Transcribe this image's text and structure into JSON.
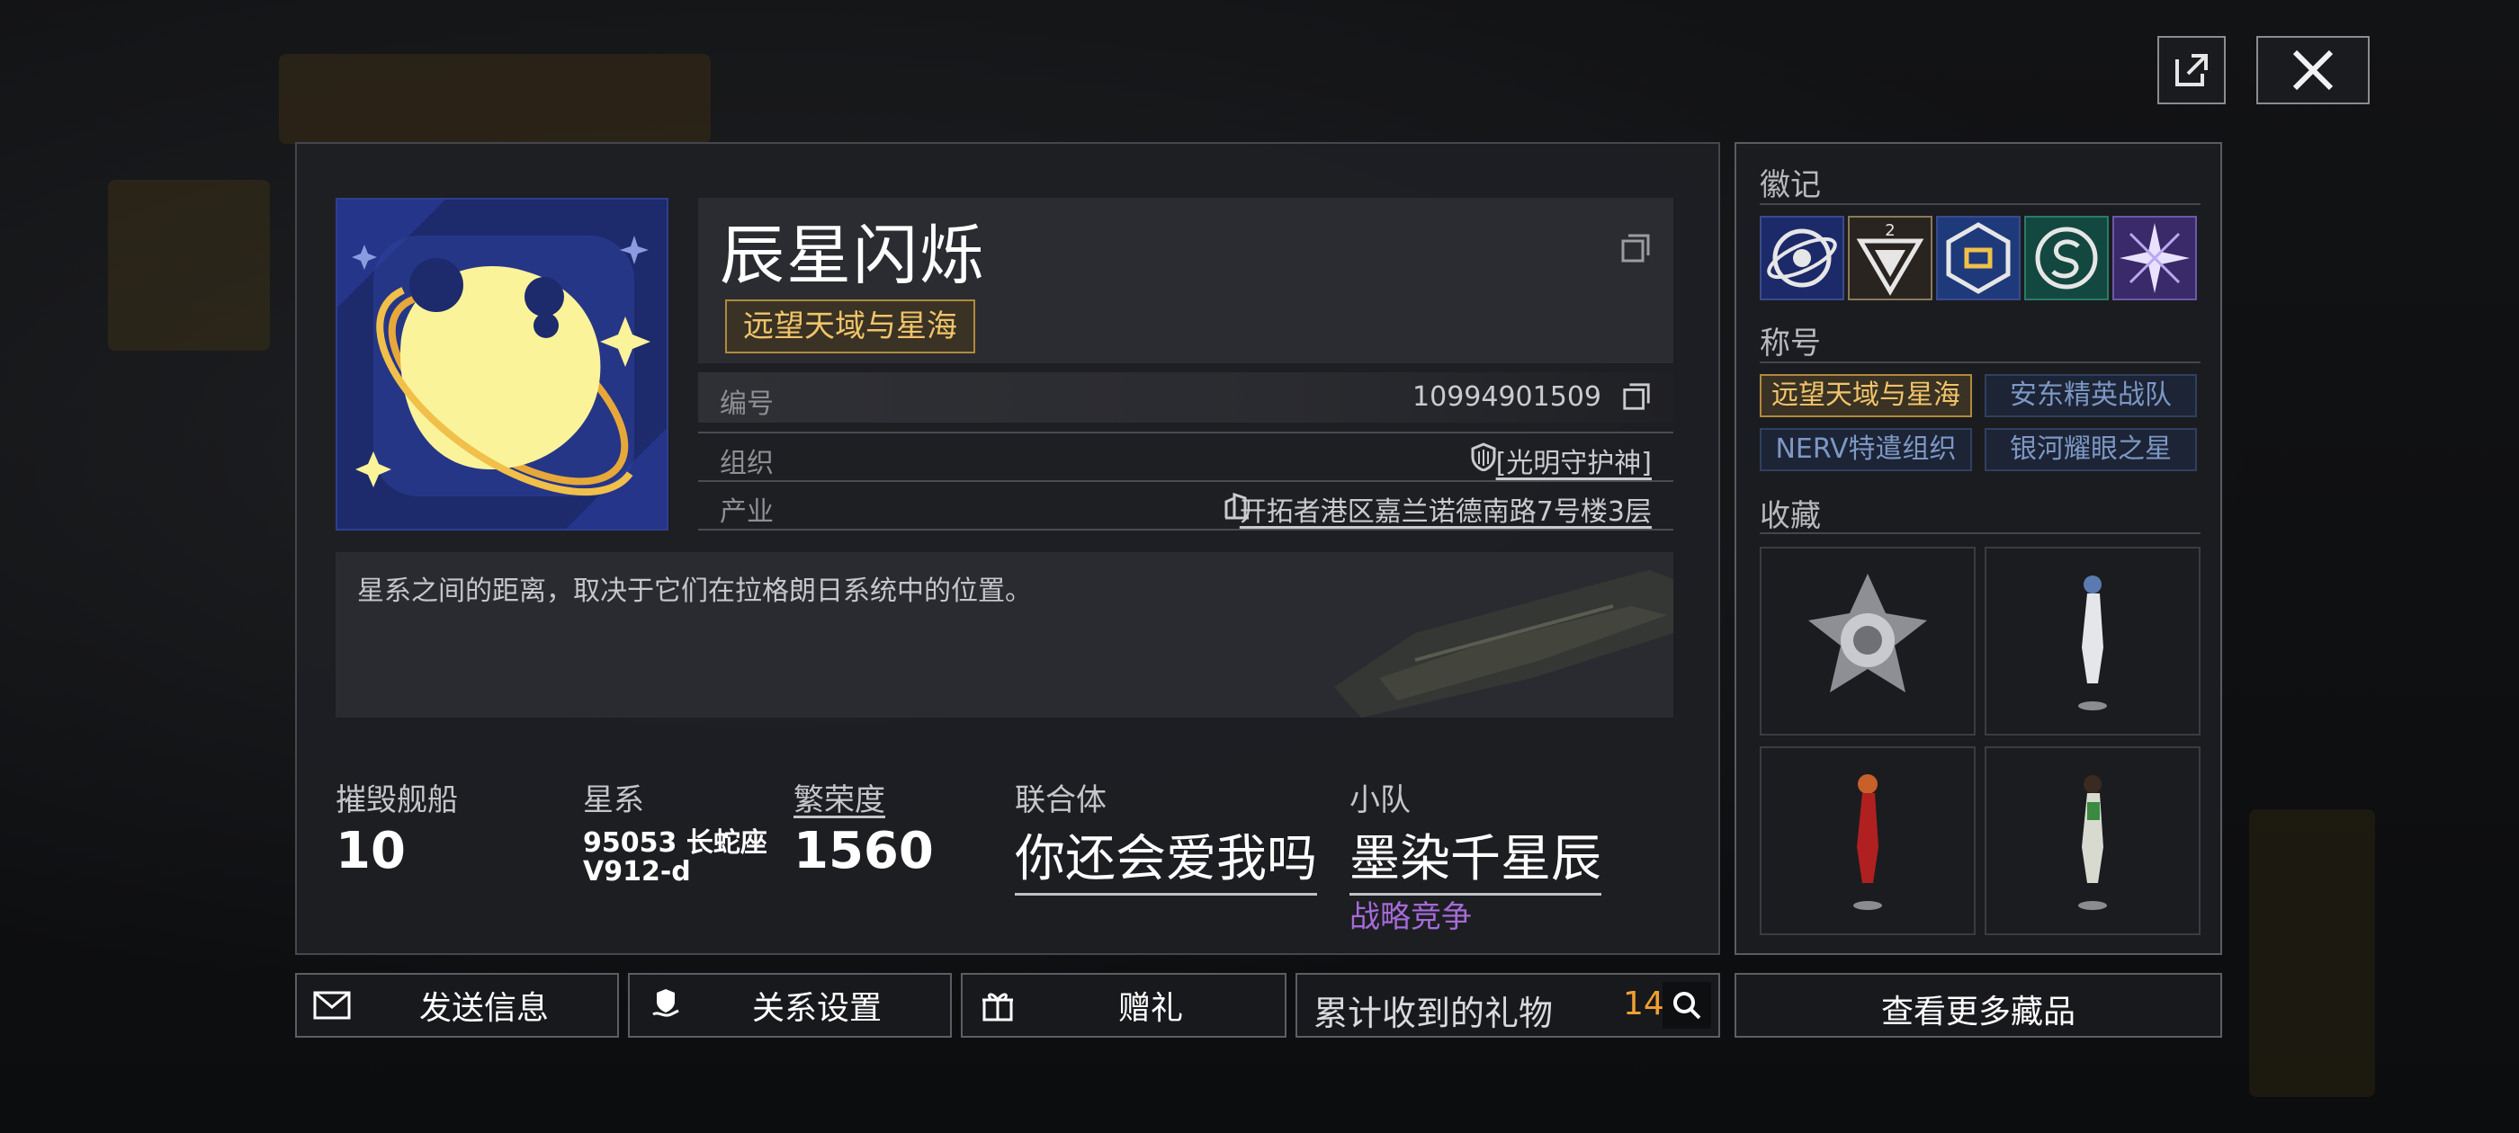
{
  "profile": {
    "name": "辰星闪烁",
    "title_tag": "远望天域与星海",
    "id_label": "编号",
    "id_value": "10994901509",
    "org_label": "组织",
    "org_value": "[光明守护神]",
    "property_label": "产业",
    "property_value": "开拓者港区嘉兰诺德南路7号楼3层",
    "motto": "星系之间的距离，取决于它们在拉格朗日系统中的位置。"
  },
  "stats": {
    "destroyed_label": "摧毁舰船",
    "destroyed_value": "10",
    "galaxy_label": "星系",
    "galaxy_line1": "95053 长蛇座",
    "galaxy_line2": "V912-d",
    "prosperity_label": "繁荣度",
    "prosperity_value": "1560",
    "union_label": "联合体",
    "union_value": "你还会爱我吗",
    "team_label": "小队",
    "team_value": "墨染千星辰",
    "team_sub": "战略竞争"
  },
  "actions": {
    "send_message": "发送信息",
    "relation_settings": "关系设置",
    "gift": "赠礼",
    "gifts_received_label": "累计收到的礼物",
    "gifts_received_value": "142",
    "view_more": "查看更多藏品"
  },
  "side": {
    "badges_heading": "徽记",
    "badge_icons": [
      "orbit-badge-icon",
      "tier2-triangle-badge-icon",
      "hexagon-badge-icon",
      "circle-s-badge-icon",
      "star-burst-badge-icon"
    ],
    "badge_number": "2",
    "titles_heading": "称号",
    "titles": [
      "远望天域与星海",
      "安东精英战队",
      "NERV特遣组织",
      "银河耀眼之星"
    ],
    "collection_heading": "收藏",
    "collection_items": [
      "medal-emblem",
      "white-suit-figure",
      "red-suit-figure",
      "green-suit-figure"
    ]
  },
  "colors": {
    "gold": "#f0c46a",
    "title_blue": "#7d97c4",
    "purple": "#a56bd8",
    "orange_count": "#f0a030",
    "avatar_bg": "#1d2a6b",
    "panda_yellow": "#fbf39a"
  }
}
